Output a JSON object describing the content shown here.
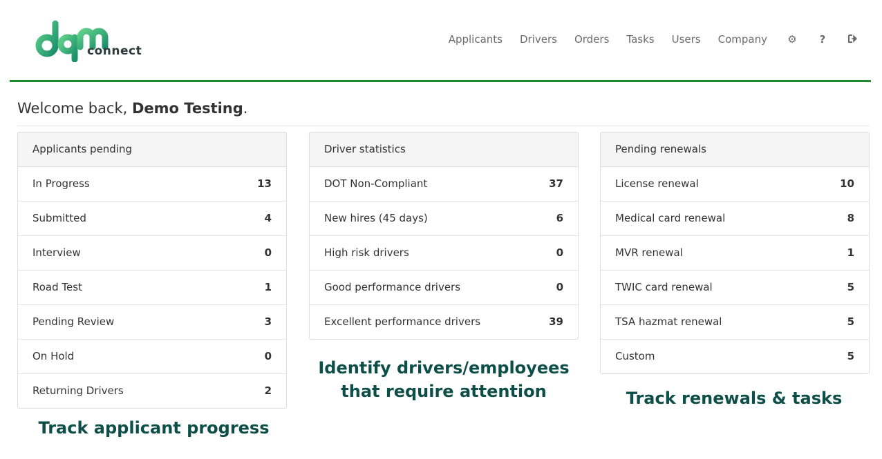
{
  "brand": {
    "logo_text": "connect"
  },
  "nav": {
    "items": [
      "Applicants",
      "Drivers",
      "Orders",
      "Tasks",
      "Users",
      "Company"
    ],
    "icons": [
      "gear-icon",
      "help-icon",
      "logout-icon"
    ]
  },
  "welcome": {
    "prefix": "Welcome back, ",
    "name": "Demo Testing",
    "suffix": "."
  },
  "panels": [
    {
      "title": "Applicants pending",
      "rows": [
        {
          "label": "In Progress",
          "value": "13"
        },
        {
          "label": "Submitted",
          "value": "4"
        },
        {
          "label": "Interview",
          "value": "0"
        },
        {
          "label": "Road Test",
          "value": "1"
        },
        {
          "label": "Pending Review",
          "value": "3"
        },
        {
          "label": "On Hold",
          "value": "0"
        },
        {
          "label": "Returning Drivers",
          "value": "2"
        }
      ]
    },
    {
      "title": "Driver statistics",
      "rows": [
        {
          "label": "DOT Non-Compliant",
          "value": "37"
        },
        {
          "label": "New hires (45 days)",
          "value": "6"
        },
        {
          "label": "High risk drivers",
          "value": "0"
        },
        {
          "label": "Good performance drivers",
          "value": "0"
        },
        {
          "label": "Excellent performance drivers",
          "value": "39"
        }
      ]
    },
    {
      "title": "Pending renewals",
      "rows": [
        {
          "label": "License renewal",
          "value": "10"
        },
        {
          "label": "Medical card renewal",
          "value": "8"
        },
        {
          "label": "MVR renewal",
          "value": "1"
        },
        {
          "label": "TWIC card renewal",
          "value": "5"
        },
        {
          "label": "TSA hazmat renewal",
          "value": "5"
        },
        {
          "label": "Custom",
          "value": "5"
        }
      ]
    }
  ],
  "captions": {
    "applicants": "Track applicant progress",
    "drivers_line1": "Identify drivers/employees",
    "drivers_line2": "that require attention",
    "renewals": "Track renewals & tasks"
  },
  "colors": {
    "accent": "#1f8a2f",
    "caption": "#0d4f48",
    "logo_green": "#2bb673"
  }
}
